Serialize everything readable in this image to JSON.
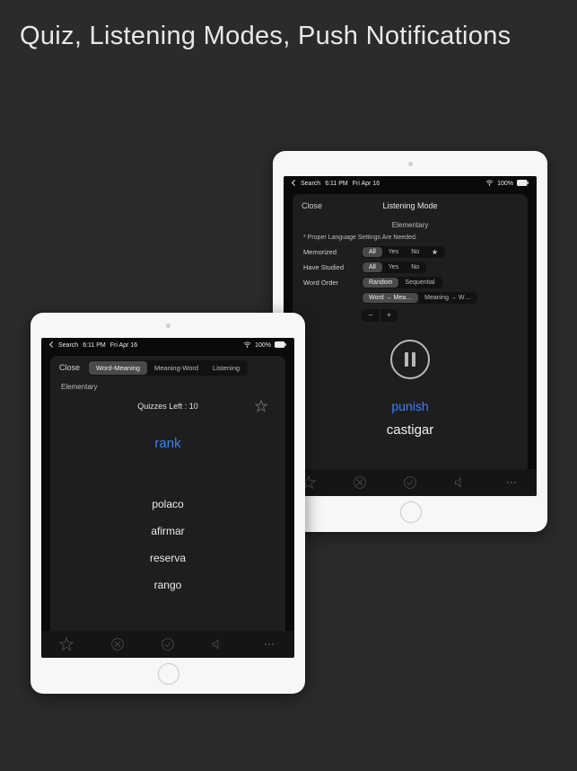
{
  "headline": "Quiz, Listening Modes, Push Notifications",
  "status": {
    "back_label": "Search",
    "time": "6:11 PM",
    "date": "Fri Apr 16",
    "battery": "100%"
  },
  "left": {
    "close": "Close",
    "tabs": [
      "Word-Meaning",
      "Meaning-Word",
      "Listening"
    ],
    "active_tab": 0,
    "level": "Elementary",
    "quizzes_left": "Quizzes Left : 10",
    "word": "rank",
    "options": [
      "polaco",
      "afirmar",
      "reserva",
      "rango"
    ]
  },
  "right": {
    "close": "Close",
    "title": "Listening Mode",
    "level": "Elementary",
    "note": "* Proper Language Settings Are Needed.",
    "rows": {
      "memorized": {
        "label": "Memorized",
        "opts": [
          "All",
          "Yes",
          "No"
        ],
        "active": 0,
        "show_star": true
      },
      "studied": {
        "label": "Have Studied",
        "opts": [
          "All",
          "Yes",
          "No"
        ],
        "active": 0
      },
      "order": {
        "label": "Word Order",
        "opts": [
          "Random",
          "Sequential"
        ],
        "active": 0
      },
      "mode": {
        "opts": [
          "Word → Mea…",
          "Meaning → W…"
        ],
        "active": 0
      }
    },
    "word": "punish",
    "meaning": "castigar"
  }
}
